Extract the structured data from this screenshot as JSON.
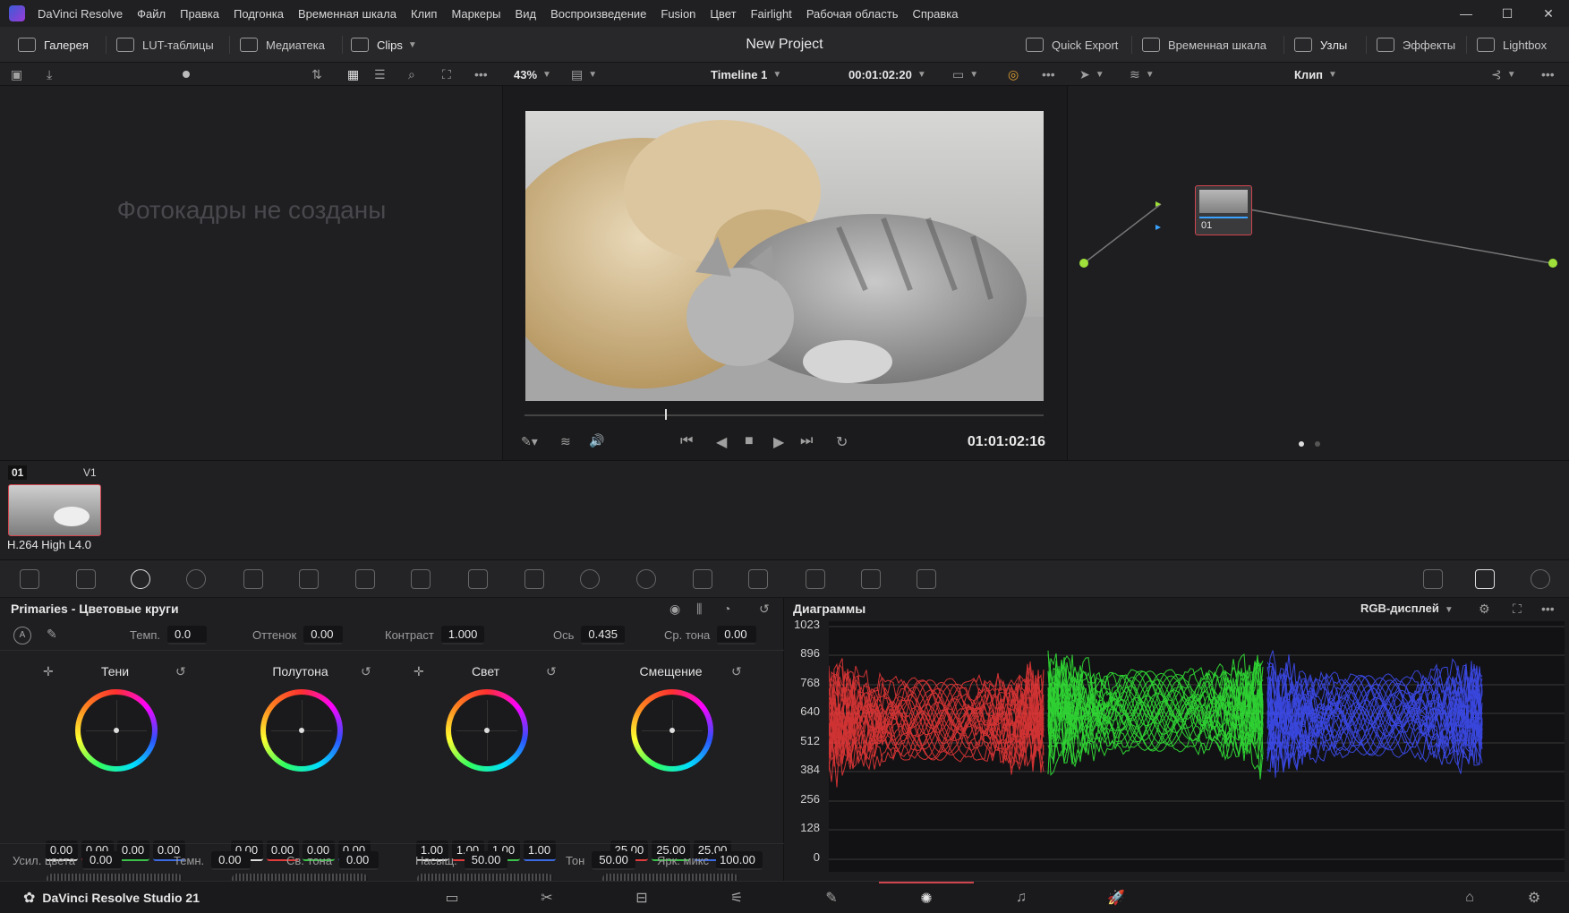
{
  "app": {
    "title": "DaVinci Resolve",
    "menu": [
      "Файл",
      "Правка",
      "Подгонка",
      "Временная шкала",
      "Клип",
      "Маркеры",
      "Вид",
      "Воспроизведение",
      "Fusion",
      "Цвет",
      "Fairlight",
      "Рабочая область",
      "Справка"
    ],
    "window_controls": [
      "—",
      "☐",
      "✕"
    ]
  },
  "toolbar": {
    "gallery": "Галерея",
    "luts": "LUT-таблицы",
    "media": "Медиатека",
    "clips": "Clips",
    "project_title": "New Project",
    "quick_export": "Quick Export",
    "timeline": "Временная шкала",
    "nodes": "Узлы",
    "effects": "Эффекты",
    "lightbox": "Lightbox"
  },
  "viewer_bar": {
    "zoom": "43%",
    "timeline_name": "Timeline 1",
    "timecode": "00:01:02:20",
    "node_mode": "Клип"
  },
  "gallery": {
    "empty_text": "Фотокадры не созданы"
  },
  "viewer": {
    "playback_timecode": "01:01:02:16",
    "progress": 0.27
  },
  "nodes": {
    "node_label": "01"
  },
  "clip_strip": {
    "clip_number": "01",
    "track": "V1",
    "codec": "H.264 High L4.0"
  },
  "primaries": {
    "title": "Primaries - Цветовые круги",
    "top_params": [
      {
        "label": "Темп.",
        "value": "0.0"
      },
      {
        "label": "Оттенок",
        "value": "0.00"
      },
      {
        "label": "Контраст",
        "value": "1.000"
      },
      {
        "label": "Ось",
        "value": "0.435"
      },
      {
        "label": "Ср. тона",
        "value": "0.00"
      }
    ],
    "wheels": [
      {
        "label": "Тени",
        "values": [
          "0.00",
          "0.00",
          "0.00",
          "0.00"
        ]
      },
      {
        "label": "Полутона",
        "values": [
          "0.00",
          "0.00",
          "0.00",
          "0.00"
        ]
      },
      {
        "label": "Свет",
        "values": [
          "1.00",
          "1.00",
          "1.00",
          "1.00"
        ]
      },
      {
        "label": "Смещение",
        "values": [
          "25.00",
          "25.00",
          "25.00"
        ]
      }
    ],
    "bottom_params": [
      {
        "label": "Усил. цвета",
        "value": "0.00"
      },
      {
        "label": "Темн.",
        "value": "0.00"
      },
      {
        "label": "Св. тона",
        "value": "0.00"
      },
      {
        "label": "Насыщ.",
        "value": "50.00"
      },
      {
        "label": "Тон",
        "value": "50.00"
      },
      {
        "label": "Ярк. микс",
        "value": "100.00"
      }
    ]
  },
  "scopes": {
    "title": "Диаграммы",
    "mode": "RGB-дисплей",
    "axis_labels": [
      "1023",
      "896",
      "768",
      "640",
      "512",
      "384",
      "256",
      "128",
      "0"
    ]
  },
  "pagebar": {
    "app_label": "DaVinci Resolve Studio 21"
  },
  "colors": {
    "accent_red": "#d0464e",
    "scope_red": "#ff3b3b",
    "scope_green": "#35ff3a",
    "scope_blue": "#4050ff"
  }
}
